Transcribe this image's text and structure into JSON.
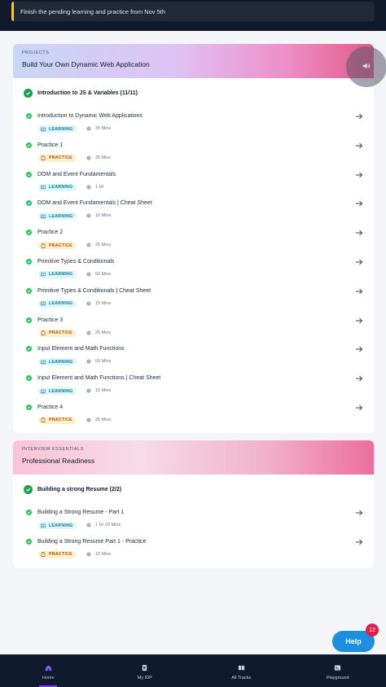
{
  "alert": {
    "text": "Finish the pending learning and practice from Nov 5th"
  },
  "projects": {
    "eyebrow": "PROJECTS",
    "title": "Build Your Own Dynamic Web Application",
    "module": {
      "title": "Introduction to JS & Variables (11/11)"
    },
    "items": [
      {
        "title": "Introduction to Dynamic Web Applications",
        "tag": "LEARNING",
        "duration": "35 Mins"
      },
      {
        "title": "Practice 1",
        "tag": "PRACTICE",
        "duration": "25 Mins"
      },
      {
        "title": "DOM and Event Fundamentals",
        "tag": "LEARNING",
        "duration": "1 Hr"
      },
      {
        "title": "DOM and Event Fundamentals | Cheat Sheet",
        "tag": "LEARNING",
        "duration": "10 Mins"
      },
      {
        "title": "Practice 2",
        "tag": "PRACTICE",
        "duration": "25 Mins"
      },
      {
        "title": "Primitive Types & Conditionals",
        "tag": "LEARNING",
        "duration": "50 Mins"
      },
      {
        "title": "Primitive Types & Conditionals | Cheat Sheet",
        "tag": "LEARNING",
        "duration": "15 Mins"
      },
      {
        "title": "Practice 3",
        "tag": "PRACTICE",
        "duration": "25 Mins"
      },
      {
        "title": "Input Element and Math Functions",
        "tag": "LEARNING",
        "duration": "55 Mins"
      },
      {
        "title": "Input Element and Math Functions | Cheat Sheet",
        "tag": "LEARNING",
        "duration": "15 Mins"
      },
      {
        "title": "Practice 4",
        "tag": "PRACTICE",
        "duration": "25 Mins"
      }
    ]
  },
  "interview": {
    "eyebrow": "INTERVIEW ESSENTIALS",
    "title": "Professional Readiness",
    "module": {
      "title": "Building a strong Resume (2/2)"
    },
    "items": [
      {
        "title": "Building a Strong Resume - Part 1",
        "tag": "LEARNING",
        "duration": "1 Hr 20 Mins"
      },
      {
        "title": "Building a Strong Resume Part 1 - Practice",
        "tag": "PRACTICE",
        "duration": "10 Mins"
      }
    ]
  },
  "help": {
    "label": "Help",
    "badge": "12"
  },
  "nav": [
    {
      "label": "Home",
      "icon": "home-icon",
      "active": true
    },
    {
      "label": "My IDP",
      "icon": "document-icon",
      "active": false
    },
    {
      "label": "All Tracks",
      "icon": "tracks-icon",
      "active": false
    },
    {
      "label": "Playground",
      "icon": "terminal-icon",
      "active": false
    }
  ],
  "colors": {
    "accent": "#7c3aed",
    "success": "#16a34a",
    "help": "#1d8fe0",
    "badge": "#e11d48"
  }
}
